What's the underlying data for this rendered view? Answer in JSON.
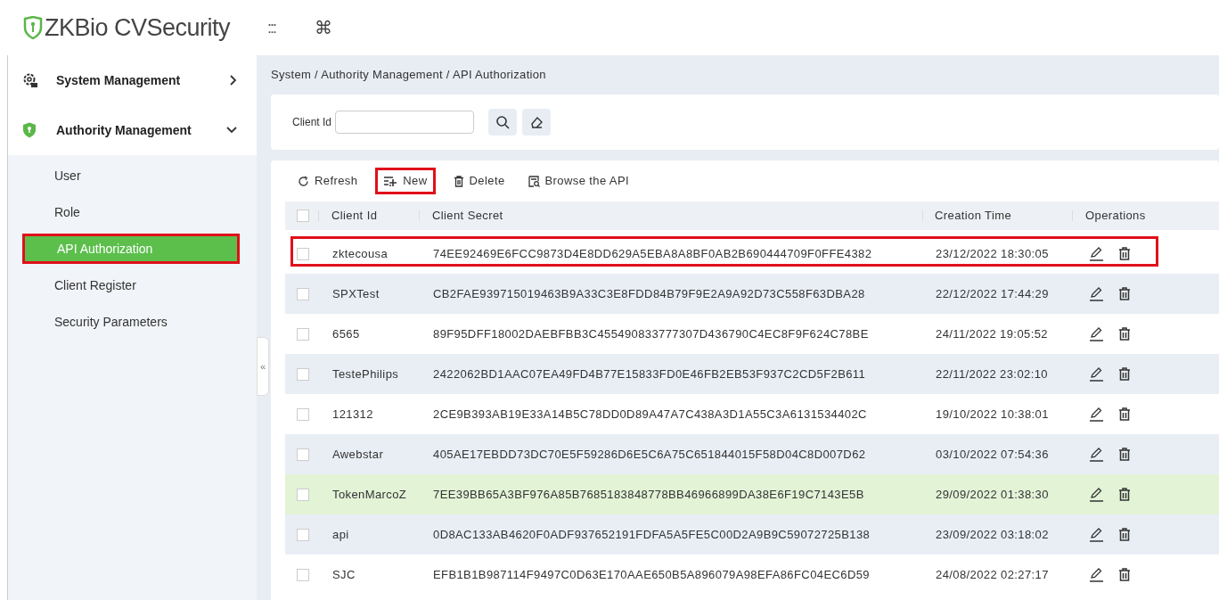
{
  "header": {
    "logo": "ZKBio CVSecurity",
    "apps_icon": ":::",
    "shortcut_icon": "⌘"
  },
  "sidebar": {
    "groups": [
      {
        "label": "System Management",
        "expanded": false
      },
      {
        "label": "Authority Management",
        "expanded": true
      }
    ],
    "items": [
      {
        "label": "User",
        "selected": false,
        "outlined": false
      },
      {
        "label": "Role",
        "selected": false,
        "outlined": false
      },
      {
        "label": "API Authorization",
        "selected": true,
        "outlined": true
      },
      {
        "label": "Client Register",
        "selected": false,
        "outlined": false
      },
      {
        "label": "Security Parameters",
        "selected": false,
        "outlined": false
      }
    ],
    "collapse": "«"
  },
  "breadcrumb": "System / Authority Management / API Authorization",
  "search": {
    "label": "Client Id"
  },
  "select_all_checked": false,
  "toolbar": [
    {
      "label": "Refresh",
      "kind": "refresh",
      "outlined": false
    },
    {
      "label": "New",
      "kind": "new",
      "outlined": true
    },
    {
      "label": "Delete",
      "kind": "delete",
      "outlined": false
    },
    {
      "label": "Browse the API",
      "kind": "browse",
      "outlined": false
    }
  ],
  "table": {
    "columns": [
      "Client Id",
      "Client Secret",
      "Creation Time",
      "Operations"
    ],
    "rows": [
      {
        "client_id": "zktecousa",
        "client_secret": "74EE92469E6FCC9873D4E8DD629A5EBA8A8BF0AB2B690444709F0FFE4382",
        "creation_time": "23/12/2022 18:30:05",
        "checked": false,
        "hovered": false,
        "outlined": true
      },
      {
        "client_id": "SPXTest",
        "client_secret": "CB2FAE939715019463B9A33C3E8FDD84B79F9E2A9A92D73C558F63DBA28",
        "creation_time": "22/12/2022 17:44:29",
        "checked": false,
        "hovered": false,
        "outlined": false
      },
      {
        "client_id": "6565",
        "client_secret": "89F95DFF18002DAEBFBB3C455490833777307D436790C4EC8F9F624C78BE",
        "creation_time": "24/11/2022 19:05:52",
        "checked": false,
        "hovered": false,
        "outlined": false
      },
      {
        "client_id": "TestePhilips",
        "client_secret": "2422062BD1AAC07EA49FD4B77E15833FD0E46FB2EB53F937C2CD5F2B611",
        "creation_time": "22/11/2022 23:02:10",
        "checked": false,
        "hovered": false,
        "outlined": false
      },
      {
        "client_id": "121312",
        "client_secret": "2CE9B393AB19E33A14B5C78DD0D89A47A7C438A3D1A55C3A6131534402C",
        "creation_time": "19/10/2022 10:38:01",
        "checked": false,
        "hovered": false,
        "outlined": false
      },
      {
        "client_id": "Awebstar",
        "client_secret": "405AE17EBDD73DC70E5F59286D6E5C6A75C651844015F58D04C8D007D62",
        "creation_time": "03/10/2022 07:54:36",
        "checked": false,
        "hovered": false,
        "outlined": false
      },
      {
        "client_id": "TokenMarcoZ",
        "client_secret": "7EE39BB65A3BF976A85B7685183848778BB46966899DA38E6F19C7143E5B",
        "creation_time": "29/09/2022 01:38:30",
        "checked": false,
        "hovered": true,
        "outlined": false
      },
      {
        "client_id": "api",
        "client_secret": "0D8AC133AB4620F0ADF937652191FDFA5A5FE5C00D2A9B9C59072725B138",
        "creation_time": "23/09/2022 03:18:02",
        "checked": false,
        "hovered": false,
        "outlined": false
      },
      {
        "client_id": "SJC",
        "client_secret": "EFB1B1B987114F9497C0D63E170AAE650B5A896079A98EFA86FC04EC6D59",
        "creation_time": "24/08/2022 02:27:17",
        "checked": false,
        "hovered": false,
        "outlined": false
      }
    ]
  }
}
